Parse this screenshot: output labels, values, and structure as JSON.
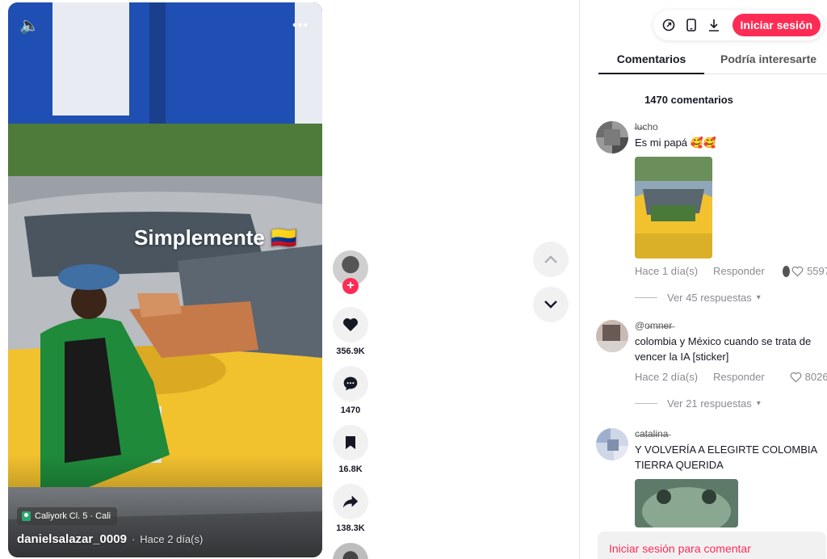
{
  "video": {
    "overlay_text": "Simplemente 🇨🇴",
    "location": "Caliyork Cl. 5 · Cali",
    "author": "danielsalazar_0009",
    "separator": "·",
    "date": "Hace 2 día(s)"
  },
  "actions": {
    "likes": "356.9K",
    "comments": "1470",
    "saves": "16.8K",
    "shares": "138.3K"
  },
  "header": {
    "login_label": "Iniciar sesión"
  },
  "tabs": [
    {
      "label": "Comentarios"
    },
    {
      "label": "Podría interesarte"
    }
  ],
  "comments_total": "1470 comentarios",
  "comments": [
    {
      "user": "l̶u̶cho",
      "text": "Es mi papá 🥰🥰",
      "time": "Hace 1 día(s)",
      "reply_label": "Responder",
      "likes": "5597",
      "replies": "Ver 45 respuestas"
    },
    {
      "user": "@o̶m̶n̶e̶r̶",
      "text": "colombia y México cuando se trata de vencer la IA [sticker]",
      "time": "Hace 2 día(s)",
      "reply_label": "Responder",
      "likes": "8026",
      "replies": "Ver 21 respuestas"
    },
    {
      "user": "c̶a̶t̶a̶l̶i̶n̶a̶",
      "text": "Y VOLVERÍA A ELEGIRTE COLOMBIA TIERRA QUERIDA"
    }
  ],
  "login_to_comment": "Iniciar sesión para comentar",
  "colors": {
    "accent": "#fe2c55",
    "taxi_yellow": "#f2c12e",
    "fence_blue": "#1f4fb3"
  }
}
